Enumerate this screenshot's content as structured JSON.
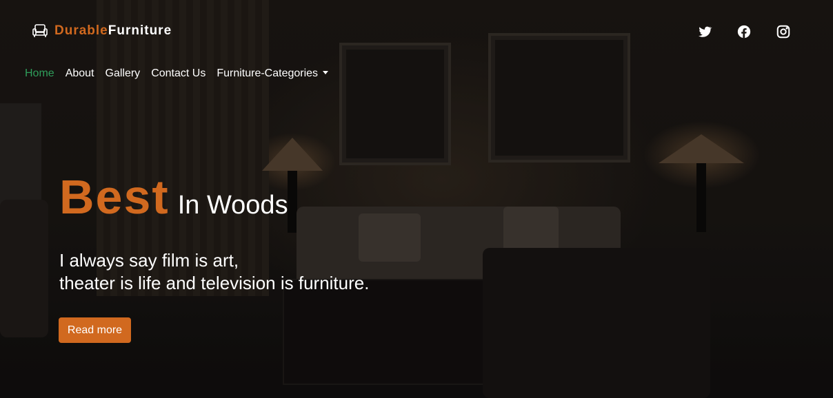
{
  "brand": {
    "part1": "Durable",
    "part2": "Furniture",
    "icon": "armchair-icon",
    "accent_color": "#d1691f"
  },
  "social": [
    {
      "name": "twitter-icon"
    },
    {
      "name": "facebook-icon"
    },
    {
      "name": "instagram-icon"
    }
  ],
  "nav": {
    "items": [
      {
        "label": "Home",
        "active": true
      },
      {
        "label": "About"
      },
      {
        "label": "Gallery"
      },
      {
        "label": "Contact Us"
      },
      {
        "label": "Furniture-Categories",
        "dropdown": true
      }
    ],
    "active_color": "#2f9e5b"
  },
  "hero": {
    "headline_big": "Best",
    "headline_small": "In Woods",
    "quote_line1": "I always say film is art,",
    "quote_line2": "theater is life and television is furniture.",
    "button_label": "Read more"
  }
}
